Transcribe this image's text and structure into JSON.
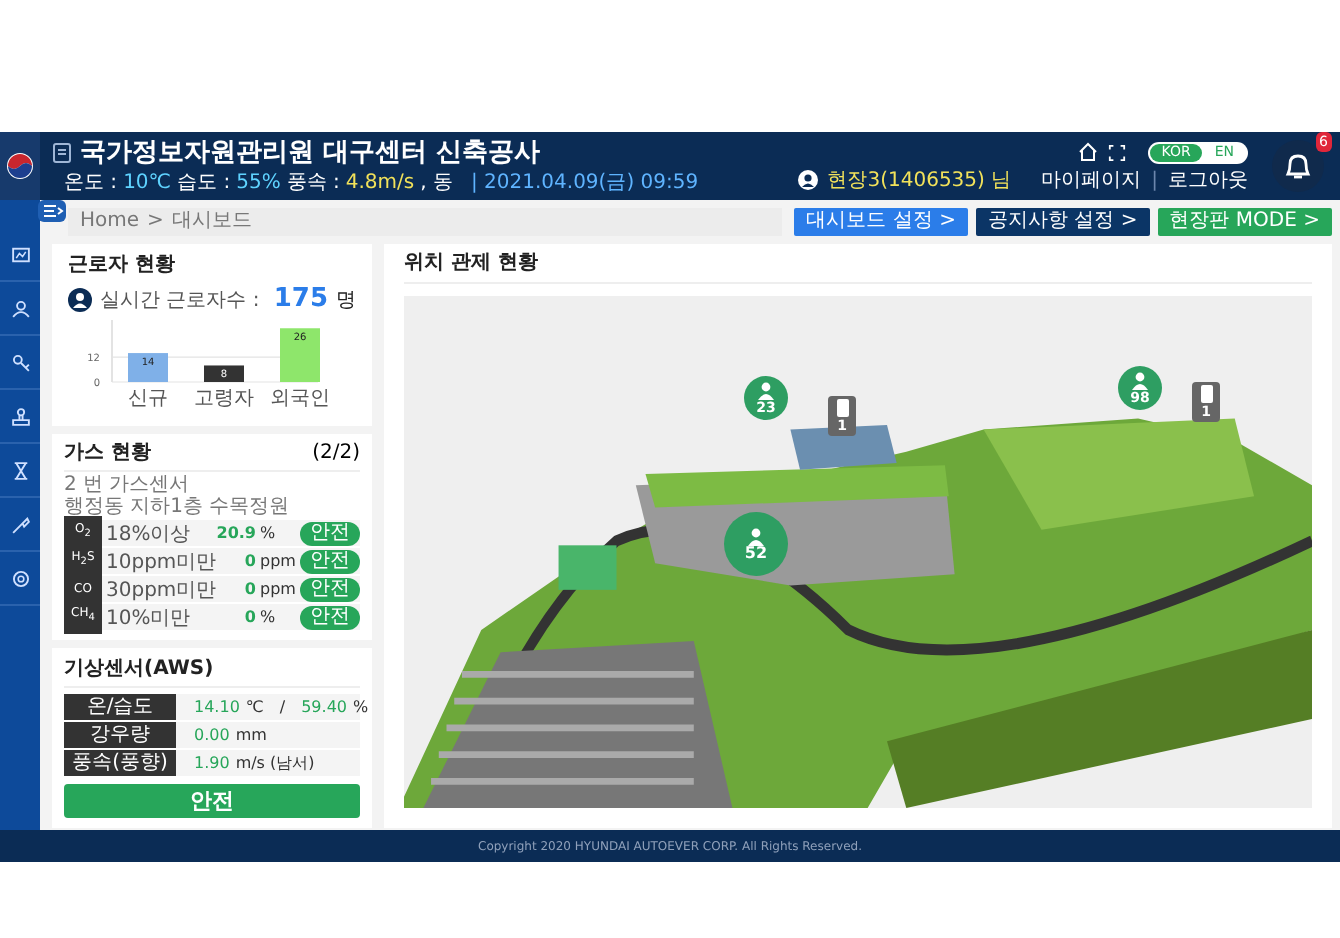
{
  "header": {
    "title": "국가정보자원관리원 대구센터 신축공사",
    "weather": [
      {
        "label": "온도 :",
        "value": "10℃",
        "color": "#5fd3ff"
      },
      {
        "label": "습도 :",
        "value": "55%",
        "color": "#5fd3ff"
      },
      {
        "label": "풍속 :",
        "value": "4.8m/s",
        "color": "#f2e25a"
      }
    ],
    "wind_direction": ", 동",
    "datetime": "| 2021.04.09(금) 09:59",
    "languages": [
      {
        "label": "KOR",
        "selected": true
      },
      {
        "label": "EN",
        "selected": false
      }
    ],
    "user": "현장3(1406535) 님",
    "links": [
      "마이페이지",
      "|",
      "로그아웃"
    ],
    "notification_count": "6"
  },
  "breadcrumb": [
    "Home",
    ">",
    "대시보드"
  ],
  "buttons": [
    {
      "label": "대시보드 설정 >",
      "color": "#2b7de9"
    },
    {
      "label": "공지사항 설정 >",
      "color": "#0b3566"
    },
    {
      "label": "현장판 MODE >",
      "color": "#27a65a"
    }
  ],
  "workers": {
    "title": "근로자 현황",
    "label": "실시간 근로자수 :",
    "count": "175",
    "unit": "명",
    "chart_data": {
      "type": "bar",
      "categories": [
        "신규",
        "고령자",
        "외국인"
      ],
      "values": [
        14,
        8,
        26
      ],
      "ylim": [
        0,
        30
      ],
      "yticks": [
        0,
        12
      ],
      "data_labels": true
    }
  },
  "gas": {
    "title": "가스 현황",
    "page": "(2/2)",
    "sensor": "2 번 가스센서",
    "location": "행정동 지하1층 수목정원",
    "rows": [
      {
        "gas": "O$_{2}$",
        "threshold": "18%이상",
        "value": "20.9",
        "unit": "%",
        "status": "안전",
        "kind": "safe"
      },
      {
        "gas": "H$_{2}$S",
        "threshold": "10ppm미만",
        "value": "0",
        "unit": "ppm",
        "status": "안전",
        "kind": "safe"
      },
      {
        "gas": "CO",
        "threshold": "30ppm미만",
        "value": "0",
        "unit": "ppm",
        "status": "안전",
        "kind": "safe"
      },
      {
        "gas": "CH$_{4}$",
        "threshold": "10%미만",
        "value": "0",
        "unit": "%",
        "status": "안전",
        "kind": "safe"
      }
    ]
  },
  "aws": {
    "title": "기상센서(AWS)",
    "rows": [
      {
        "label": "온/습도",
        "value": "14.10",
        "unit": "℃",
        "separator": "/",
        "value_2": "59.40",
        "unit_2": "%"
      },
      {
        "label": "강우량",
        "value": "0.00",
        "unit": "mm"
      },
      {
        "label": "풍속(풍향)",
        "value": "1.90",
        "unit": "m/s (남서)"
      }
    ],
    "status": "안전",
    "kind": "safe"
  },
  "map": {
    "title": "위치 관제 현황",
    "pins": [
      {
        "kind": "worker",
        "count": "23"
      },
      {
        "kind": "device",
        "count": "1"
      },
      {
        "kind": "worker",
        "count": "98"
      },
      {
        "kind": "device",
        "count": "1"
      },
      {
        "kind": "worker",
        "count": "52"
      }
    ]
  },
  "footer": "Copyright 2020 HYUNDAI AUTOEVER CORP. All Rights Reserved."
}
